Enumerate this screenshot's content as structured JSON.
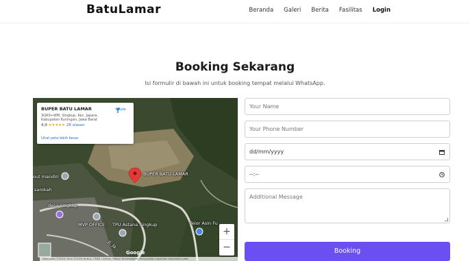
{
  "brand": "BatuLamar",
  "nav": {
    "items": [
      "Beranda",
      "Galeri",
      "Berita",
      "Fasilitas"
    ],
    "login": "Login"
  },
  "hero": {
    "title": "Booking Sekarang",
    "subtitle": "Isi formulir di bawah ini untuk booking tempat melalui WhatsApp."
  },
  "map": {
    "place_name": "BUPER BATU LAMAR",
    "address": "3GR9+WM, Singkup, Kec. Japara, Kabupaten Kuningan, Jawa Barat",
    "rating_value": "4,9",
    "stars": "★★★★★",
    "reviews": "28 ulasan",
    "route_label": "Rute",
    "larger_map": "Lihat peta lebih besar",
    "labels": {
      "pin": "BUPER BATU LAMAR",
      "mandiri": "out mandiri",
      "sarokah": "sarokah",
      "desa": "desa singkup",
      "mvp": "MVP OFFICE",
      "tpu": "TPU Astana Singkup",
      "telor": "Telor Asin Fu",
      "ji": "Jl. Ja..."
    },
    "zoom_in": "+",
    "zoom_out": "−",
    "google": "Google",
    "attribution": "Data peta ©2024 Citra ©2024 Airbus, CNES / Airbus, Maxar Technologies   Persyaratan   Laporkan kesalahan peta"
  },
  "form": {
    "name_placeholder": "Your Name",
    "phone_placeholder": "Your Phone Number",
    "date_placeholder": "dd/mm/yyyy",
    "time_placeholder": "--:--",
    "message_placeholder": "Additional Message",
    "submit": "Booking"
  },
  "colors": {
    "accent": "#6b4ff2",
    "pin": "#e53935"
  }
}
